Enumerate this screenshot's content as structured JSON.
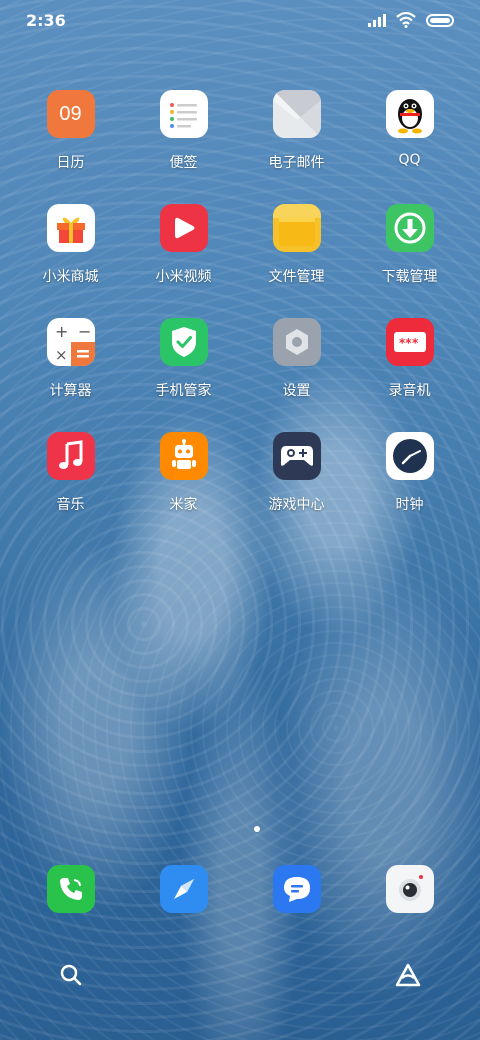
{
  "status_bar": {
    "time": "2:36"
  },
  "apps": [
    {
      "label": "日历",
      "icon": "calendar-icon",
      "calendar_day": "09"
    },
    {
      "label": "便签",
      "icon": "notes-icon"
    },
    {
      "label": "电子邮件",
      "icon": "email-icon"
    },
    {
      "label": "QQ",
      "icon": "qq-penguin-icon"
    },
    {
      "label": "小米商城",
      "icon": "gift-box-icon"
    },
    {
      "label": "小米视频",
      "icon": "video-play-icon"
    },
    {
      "label": "文件管理",
      "icon": "folder-icon"
    },
    {
      "label": "下载管理",
      "icon": "download-arrow-icon"
    },
    {
      "label": "计算器",
      "icon": "calculator-icon"
    },
    {
      "label": "手机管家",
      "icon": "shield-check-icon"
    },
    {
      "label": "设置",
      "icon": "gear-icon"
    },
    {
      "label": "录音机",
      "icon": "recorder-icon"
    },
    {
      "label": "音乐",
      "icon": "music-note-icon"
    },
    {
      "label": "米家",
      "icon": "robot-icon"
    },
    {
      "label": "游戏中心",
      "icon": "gamepad-icon"
    },
    {
      "label": "时钟",
      "icon": "clock-icon"
    }
  ],
  "dock": [
    {
      "name": "phone",
      "icon": "phone-icon"
    },
    {
      "name": "browser",
      "icon": "compass-icon"
    },
    {
      "name": "messages",
      "icon": "message-bubble-icon"
    },
    {
      "name": "camera",
      "icon": "camera-icon"
    }
  ],
  "bottom_bar": {
    "left_icon": "search-icon",
    "right_icon": "assistant-icon"
  },
  "colors": {
    "calendar": "#f0783c",
    "video": "#ee3344",
    "folder": "#f7c229",
    "download": "#3dc463",
    "security": "#2bc466",
    "recorder": "#ee2b3b",
    "music": "#ef3449",
    "mijia": "#ff8a00",
    "game": "#2e3a55",
    "phone": "#29c24b",
    "browser": "#2f8cf0",
    "messages": "#2b78f0"
  }
}
